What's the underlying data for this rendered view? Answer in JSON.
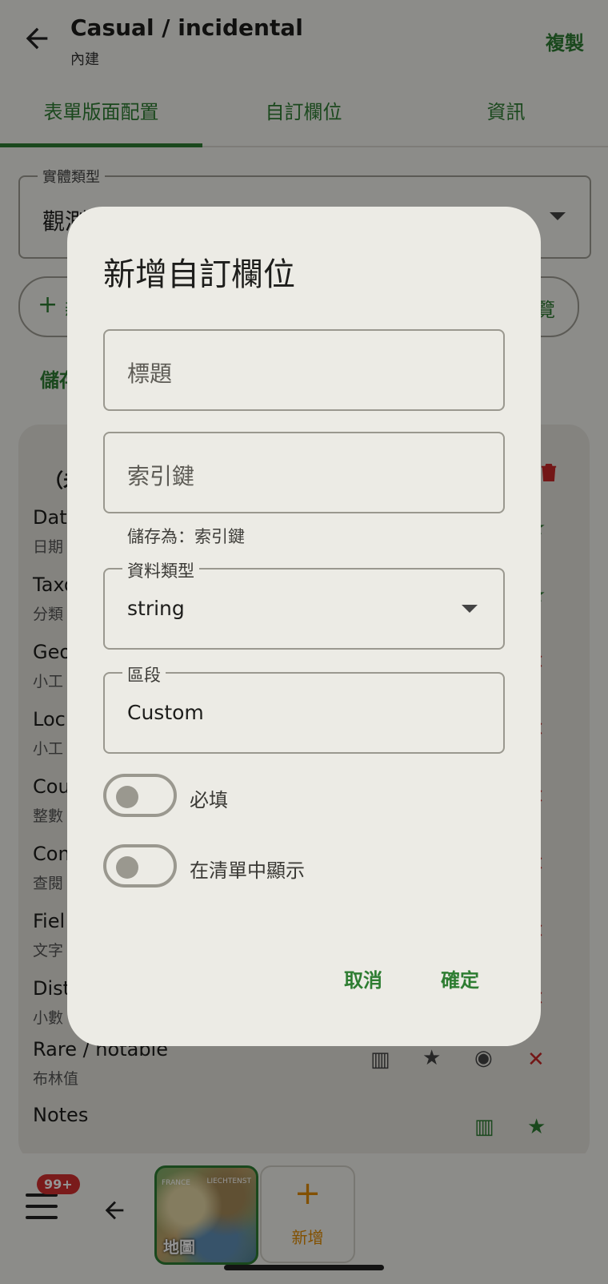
{
  "header": {
    "title": "Casual / incidental",
    "subtitle": "內建",
    "copy_label": "複製"
  },
  "tabs": [
    {
      "label": "表單版面配置"
    },
    {
      "label": "自訂欄位"
    },
    {
      "label": "資訊"
    }
  ],
  "entity_type": {
    "label": "實體類型",
    "value": "觀測"
  },
  "buttons": {
    "add_label": "新",
    "preview_label": "覽"
  },
  "save_link": "儲存",
  "card": {
    "header": "（未",
    "rows": [
      {
        "title": "Date",
        "sub": "日期"
      },
      {
        "title": "Taxo",
        "sub": "分類"
      },
      {
        "title": "Geo",
        "sub": "小工"
      },
      {
        "title": "Loc",
        "sub": "小工"
      },
      {
        "title": "Cou",
        "sub": "整數"
      },
      {
        "title": "Con",
        "sub": "查閱"
      },
      {
        "title": "Fiel",
        "sub": "文字"
      },
      {
        "title": "Dist",
        "sub": "小數"
      },
      {
        "title": "Rare / notable",
        "sub": "布林值"
      },
      {
        "title": "Notes",
        "sub": ""
      }
    ]
  },
  "bottom_nav": {
    "badge": "99+",
    "map_label": "地圖",
    "map_tiny_left": "FRANCE",
    "map_tiny_right": "LIECHTENST",
    "add_label": "新增"
  },
  "dialog": {
    "title": "新增自訂欄位",
    "title_placeholder": "標題",
    "key_placeholder": "索引鍵",
    "helper": "儲存為：索引鍵",
    "data_type": {
      "label": "資料類型",
      "value": "string"
    },
    "section": {
      "label": "區段",
      "value": "Custom"
    },
    "required_label": "必填",
    "show_in_list_label": "在清單中顯示",
    "cancel_label": "取消",
    "confirm_label": "確定"
  }
}
